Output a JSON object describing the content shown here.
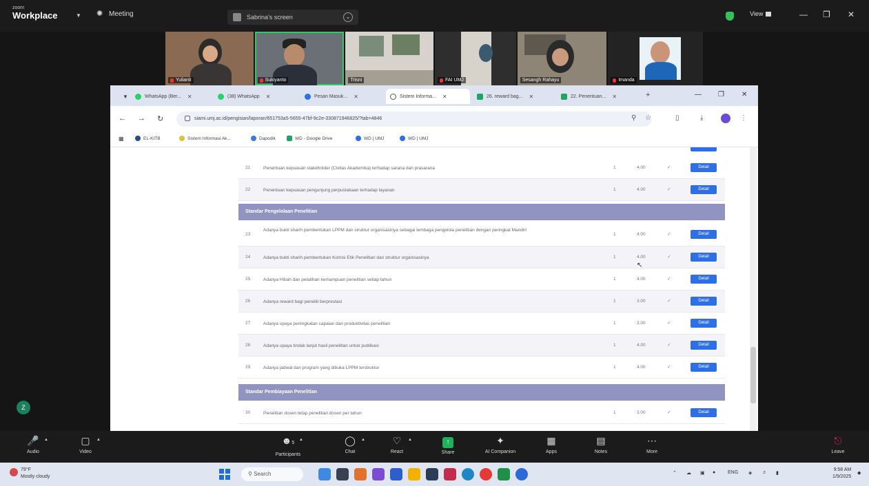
{
  "zoom": {
    "brand_small": "zoom",
    "brand_big": "Workplace",
    "meeting_label": "Meeting",
    "share_banner": "Sabrina's screen",
    "view_label": "View",
    "participants_count": "5",
    "toolbar": {
      "audio": "Audio",
      "video": "Video",
      "participants": "Participants",
      "chat": "Chat",
      "react": "React",
      "share": "Share",
      "ai_companion": "AI Companion",
      "apps": "Apps",
      "notes": "Notes",
      "more": "More",
      "leave": "Leave"
    },
    "participants": [
      {
        "name": "Yulianti"
      },
      {
        "name": "Sukiyanto"
      },
      {
        "name": "Trisni"
      },
      {
        "name": "FAI UMJ"
      },
      {
        "name": "Sesangh Rahayu"
      },
      {
        "name": "Imanda"
      }
    ],
    "chat_avatar": "Z"
  },
  "browser": {
    "tabs": [
      {
        "label": "WhatsApp (Ber..."
      },
      {
        "label": "(38) WhatsApp"
      },
      {
        "label": "Pesan Masuk..."
      },
      {
        "label": "Sistem Informa..."
      },
      {
        "label": "26. reward bag..."
      },
      {
        "label": "22. Penentuan..."
      }
    ],
    "url": "siami.umj.ac.id/pengisian/laporan/651753a5-5655-47bf-9c2e-330871946825/?tab=4846",
    "bookmarks": [
      {
        "label": "EL-KITB"
      },
      {
        "label": "Sistem Informasi Ak..."
      },
      {
        "label": "Dapodik"
      },
      {
        "label": "WD - Google Drive"
      },
      {
        "label": "WD | UMJ"
      },
      {
        "label": "WD | UMJ"
      }
    ]
  },
  "table": {
    "rows_top": [
      {
        "num": "21",
        "desc": "Penentuan kepuasan stakeholder (Civitas Akademika) terhadap sarana dan prasarana",
        "one": "1",
        "score": "4.00",
        "chk": "✓",
        "btn": "Detail"
      },
      {
        "num": "22",
        "desc": "Penentuan kepuasan pengunjung perpustakaan terhadap layanan",
        "one": "1",
        "score": "4.00",
        "chk": "✓",
        "btn": "Detail"
      }
    ],
    "section1": "Standar Pengelolaan Penelitian",
    "rows_mid": [
      {
        "num": "23",
        "desc": "Adanya bukti sharih pembentukan LPPM dan struktur organisasinya sebagai lembaga pengelola penelitian dengan peringkat Mandiri",
        "one": "1",
        "score": "4.00",
        "chk": "✓",
        "btn": "Detail"
      },
      {
        "num": "24",
        "desc": "Adanya bukti sharih pembentukan Komisi Etik Penelitian dan struktur organisasinya",
        "one": "1",
        "score": "4.00",
        "chk": "✓",
        "btn": "Detail"
      },
      {
        "num": "25",
        "desc": "Adanya Hibah dan pelatihan kemampuan penelitian setiap tahun",
        "one": "1",
        "score": "4.00",
        "chk": "✓",
        "btn": "Detail"
      },
      {
        "num": "26",
        "desc": "Adanya reward bagi peneliti berprestasi",
        "one": "1",
        "score": "3.00",
        "chk": "✓",
        "btn": "Detail"
      },
      {
        "num": "27",
        "desc": "Adanya upaya peningkatan capaian dan produktivitas penelitian",
        "one": "1",
        "score": "3.00",
        "chk": "✓",
        "btn": "Detail"
      },
      {
        "num": "28",
        "desc": "Adanya upaya tindak lanjut hasil penelitian untuk publikasi",
        "one": "1",
        "score": "4.00",
        "chk": "✓",
        "btn": "Detail"
      },
      {
        "num": "29",
        "desc": "Adanya jadwal dan program yang dibuka LPPM terstruktur",
        "one": "1",
        "score": "4.00",
        "chk": "✓",
        "btn": "Detail"
      }
    ],
    "section2": "Standar Pembiayaan Penelitian",
    "rows_bottom": [
      {
        "num": "30",
        "desc": "Penelitian dosen tetap penelitian dosen per tahun",
        "one": "1",
        "score": "3.00",
        "chk": "✓",
        "btn": "Detail"
      }
    ]
  },
  "taskbar": {
    "weather_temp": "79°F",
    "weather_desc": "Mostly cloudy",
    "search": "Search",
    "lang": "ENG",
    "time": "9:58 AM",
    "date": "1/9/2025"
  }
}
